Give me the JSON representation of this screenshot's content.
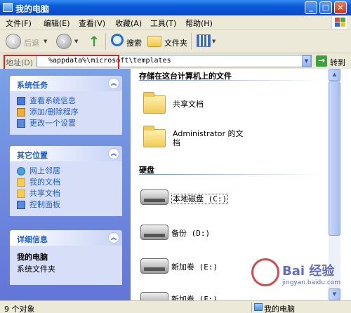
{
  "window": {
    "title": "我的电脑"
  },
  "menu": [
    "文件(F)",
    "编辑(E)",
    "查看(V)",
    "收藏(A)",
    "工具(T)",
    "帮助(H)"
  ],
  "toolbar": {
    "back_label": "后退",
    "search_label": "搜索",
    "folders_label": "文件夹"
  },
  "address": {
    "label": "地址(D)",
    "value": "%appdata%\\microsoft\\templates",
    "go_label": "转到"
  },
  "system_tasks": {
    "title": "系统任务",
    "items": [
      "查看系统信息",
      "添加/删除程序",
      "更改一个设置"
    ]
  },
  "other_places": {
    "title": "其它位置",
    "items": [
      "网上邻居",
      "我的文档",
      "共享文档",
      "控制面板"
    ]
  },
  "details": {
    "title": "详细信息",
    "name": "我的电脑",
    "type": "系统文件夹"
  },
  "content": {
    "files_header": "存储在这台计算机上的文件",
    "folders": [
      "共享文档",
      "Administrator 的文档"
    ],
    "drives_header": "硬盘",
    "drives": [
      "本地磁盘 (C:)",
      "备份 (D:)",
      "新加卷 (E:)",
      "新加卷 (F:)"
    ]
  },
  "status": {
    "left": "9 个对象",
    "right": "我的电脑"
  },
  "watermark": {
    "brand": "Bai 经验",
    "url": "jingyan.baidu.com"
  }
}
